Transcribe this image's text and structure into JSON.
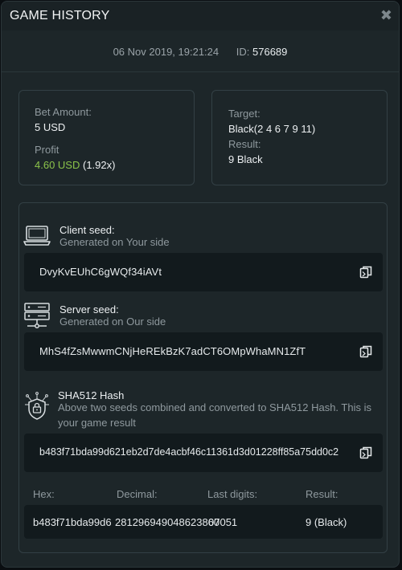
{
  "header": {
    "title": "GAME HISTORY",
    "close_icon": "close-icon"
  },
  "meta": {
    "datetime": "06 Nov 2019, 19:21:24",
    "id_label": "ID:",
    "id_value": "576689"
  },
  "bet": {
    "bet_amount_label": "Bet Amount:",
    "bet_amount_value": "5 USD",
    "profit_label": "Profit",
    "profit_value": "4.60 USD",
    "profit_multiplier": "(1.92x)",
    "profit_color": "#8bc34a"
  },
  "target": {
    "target_label": "Target:",
    "target_value": "Black(2 4 6 7 9 11)",
    "result_label": "Result:",
    "result_value": "9 Black"
  },
  "client_seed": {
    "title": "Client seed:",
    "subtitle": "Generated on Your side",
    "value": "DvyKvEUhC6gWQf34iAVt",
    "icon": "laptop-icon"
  },
  "server_seed": {
    "title": "Server seed:",
    "subtitle": "Generated on Our side",
    "value": "MhS4fZsMwwmCNjHeREkBzK7adCT6OMpWhaMN1ZfT",
    "icon": "server-icon"
  },
  "hash": {
    "title": "SHA512 Hash",
    "subtitle": "Above two seeds combined and converted to SHA512 Hash. This is your game result",
    "value": "b483f71bda99d621eb2d7de4acbf46c11361d3d01228ff85a75dd0c2",
    "icon": "shield-lock-icon"
  },
  "result_table": {
    "hex_label": "Hex:",
    "decimal_label": "Decimal:",
    "last_digits_label": "Last digits:",
    "result_label": "Result:",
    "hex_value": "b483f71bda99d6",
    "decimal_value": "281296949048623860",
    "last_digits_value": "07051",
    "result_value": "9 (Black)"
  },
  "colors": {
    "background": "#1d2629",
    "field": "#121a1d",
    "accent_green": "#8bc34a"
  }
}
